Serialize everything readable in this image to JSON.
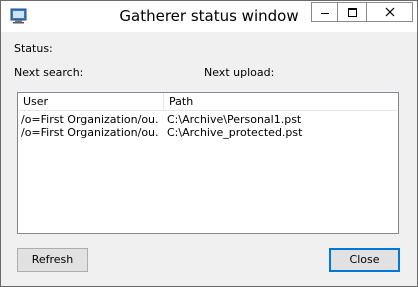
{
  "window": {
    "title": "Gatherer status window"
  },
  "status": {
    "status_label": "Status:",
    "next_search_label": "Next search:",
    "next_upload_label": "Next upload:"
  },
  "list": {
    "columns": [
      "User",
      "Path"
    ],
    "rows": [
      {
        "user": "/o=First Organization/ou...",
        "path": "C:\\Archive\\Personal1.pst"
      },
      {
        "user": "/o=First Organization/ou...",
        "path": "C:\\Archive_protected.pst"
      }
    ]
  },
  "buttons": {
    "refresh": "Refresh",
    "close": "Close"
  },
  "colors": {
    "window_bg": "#f0f0f0",
    "titlebar_bg": "#ffffff",
    "default_button_border": "#0078d7"
  },
  "icons": {
    "app": "gatherer-app-icon",
    "minimize": "minimize-icon",
    "maximize": "maximize-icon",
    "close": "close-icon"
  }
}
